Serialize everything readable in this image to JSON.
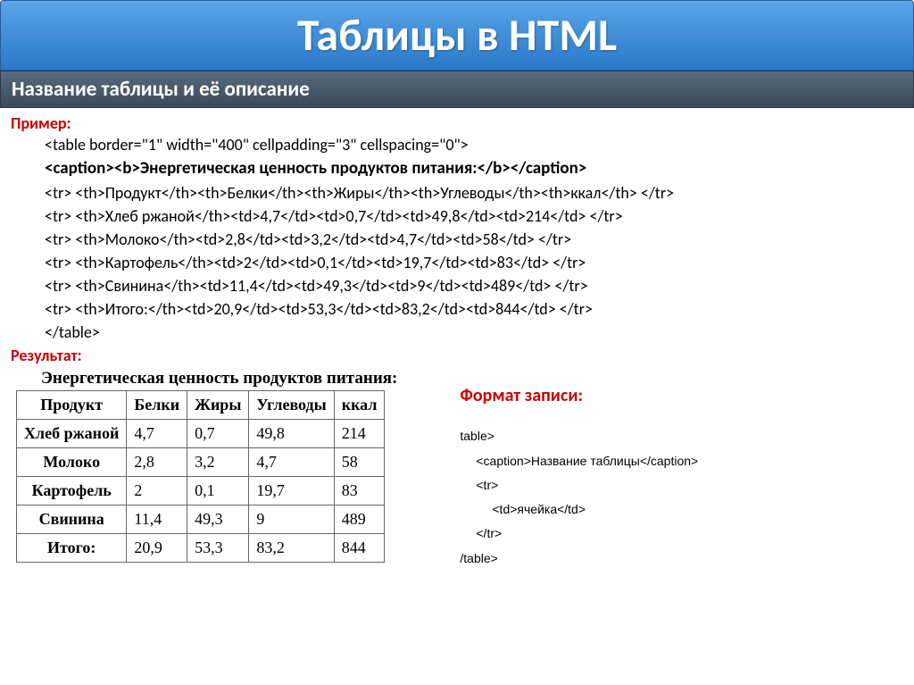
{
  "title": "Таблицы в HTML",
  "subtitle": "Название таблицы и её описание",
  "labels": {
    "example": "Пример:",
    "result": "Результат:",
    "format": "Формат записи:"
  },
  "code": {
    "l1": "<table border=\"1\" width=\"400\" cellpadding=\"3\" cellspacing=\"0\">",
    "l2": "<caption><b>Энергетическая ценность продуктов питания:</b></caption>",
    "l3": "<tr> <th>Продукт</th><th>Белки</th><th>Жиры</th><th>Углеводы</th><th>ккал</th> </tr>",
    "l4": "<tr> <th>Хлеб ржаной</th><td>4,7</td><td>0,7</td><td>49,8</td><td>214</td> </tr>",
    "l5": "<tr> <th>Молоко</th><td>2,8</td><td>3,2</td><td>4,7</td><td>58</td> </tr>",
    "l6": "<tr> <th>Картофель</th><td>2</td><td>0,1</td><td>19,7</td><td>83</td> </tr>",
    "l7": "<tr> <th>Свинина</th><td>11,4</td><td>49,3</td><td>9</td><td>489</td> </tr>",
    "l8": "<tr> <th>Итого:</th><td>20,9</td><td>53,3</td><td>83,2</td><td>844</td> </tr>",
    "l9": "</table>"
  },
  "result_table": {
    "caption": "Энергетическая ценность продуктов питания:",
    "headers": [
      "Продукт",
      "Белки",
      "Жиры",
      "Углеводы",
      "ккал"
    ],
    "rows": [
      {
        "name": "Хлеб ржаной",
        "c1": "4,7",
        "c2": "0,7",
        "c3": "49,8",
        "c4": "214"
      },
      {
        "name": "Молоко",
        "c1": "2,8",
        "c2": "3,2",
        "c3": "4,7",
        "c4": "58"
      },
      {
        "name": "Картофель",
        "c1": "2",
        "c2": "0,1",
        "c3": "19,7",
        "c4": "83"
      },
      {
        "name": "Свинина",
        "c1": "11,4",
        "c2": "49,3",
        "c3": "9",
        "c4": "489"
      },
      {
        "name": "Итого:",
        "c1": "20,9",
        "c2": "53,3",
        "c3": "83,2",
        "c4": "844"
      }
    ]
  },
  "format_code": {
    "f1": "table>",
    "f2": "<caption>Название таблицы</caption>",
    "f3": "<tr>",
    "f4": "<td>ячейка</td>",
    "f5": "</tr>",
    "f6": "/table>"
  }
}
